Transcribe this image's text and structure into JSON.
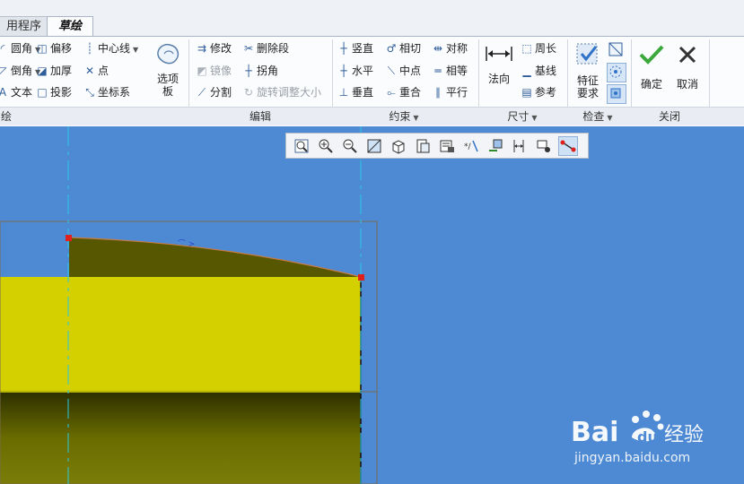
{
  "tabs": [
    {
      "label": "用程序",
      "active": false
    },
    {
      "label": "草绘",
      "active": true
    }
  ],
  "ribbon": {
    "sketch_group": {
      "items": [
        {
          "label": "圆角",
          "icon": "fillet-icon",
          "dropdown": true
        },
        {
          "label": "倒角",
          "icon": "chamfer-icon",
          "dropdown": true
        },
        {
          "label": "文本",
          "icon": "text-icon"
        },
        {
          "label": "偏移",
          "icon": "offset-icon"
        },
        {
          "label": "加厚",
          "icon": "thicken-icon"
        },
        {
          "label": "投影",
          "icon": "project-icon"
        },
        {
          "label": "中心线",
          "icon": "centerline-icon",
          "dropdown": true
        },
        {
          "label": "点",
          "icon": "point-icon"
        },
        {
          "label": "坐标系",
          "icon": "coordinate-system-icon"
        }
      ],
      "palette": "选项板",
      "label": "绘"
    },
    "edit_group": {
      "items": [
        {
          "label": "修改",
          "icon": "modify-icon",
          "enabled": true
        },
        {
          "label": "镜像",
          "icon": "mirror-icon",
          "enabled": false
        },
        {
          "label": "分割",
          "icon": "divide-icon",
          "enabled": true
        },
        {
          "label": "删除段",
          "icon": "delete-segment-icon",
          "enabled": true
        },
        {
          "label": "拐角",
          "icon": "corner-icon",
          "enabled": true
        },
        {
          "label": "旋转调整大小",
          "icon": "rotate-resize-icon",
          "enabled": false
        }
      ],
      "label": "编辑"
    },
    "constrain_group": {
      "items": [
        {
          "label": "竖直",
          "icon": "vertical-icon"
        },
        {
          "label": "水平",
          "icon": "horizontal-icon"
        },
        {
          "label": "垂直",
          "icon": "perpendicular-icon"
        },
        {
          "label": "相切",
          "icon": "tangent-icon"
        },
        {
          "label": "中点",
          "icon": "midpoint-icon"
        },
        {
          "label": "重合",
          "icon": "coincident-icon"
        },
        {
          "label": "对称",
          "icon": "symmetric-icon"
        },
        {
          "label": "相等",
          "icon": "equal-icon"
        },
        {
          "label": "平行",
          "icon": "parallel-icon"
        }
      ],
      "label": "约束"
    },
    "dimension_group": {
      "normal": "法向",
      "items": [
        {
          "label": "周长",
          "icon": "perimeter-icon"
        },
        {
          "label": "基线",
          "icon": "baseline-icon"
        },
        {
          "label": "参考",
          "icon": "reference-icon"
        }
      ],
      "label": "尺寸"
    },
    "inspect_group": {
      "feature_req": "特征要求",
      "label": "检查"
    },
    "close_group": {
      "ok": "确定",
      "cancel": "取消",
      "label": "关闭"
    }
  },
  "view_toolbar": [
    "refit-icon",
    "zoom-in-icon",
    "zoom-out-icon",
    "repaint-icon",
    "display-style-icon",
    "saved-orientations-icon",
    "view-manager-icon",
    "dimension-display-icon",
    "constraint-display-icon",
    "grid-display-icon",
    "vertex-display-icon",
    "sketch-view-icon"
  ],
  "watermark": {
    "text": "jingyan.baidu.com",
    "logo": "Baidu经验"
  },
  "colors": {
    "canvas": "#4e8ad4",
    "part_yellow": "#d4d000",
    "part_dark": "#4f5200",
    "construction": "#29c8e0",
    "vertex": "#e0201c",
    "sketch_line": "#c87a40"
  }
}
